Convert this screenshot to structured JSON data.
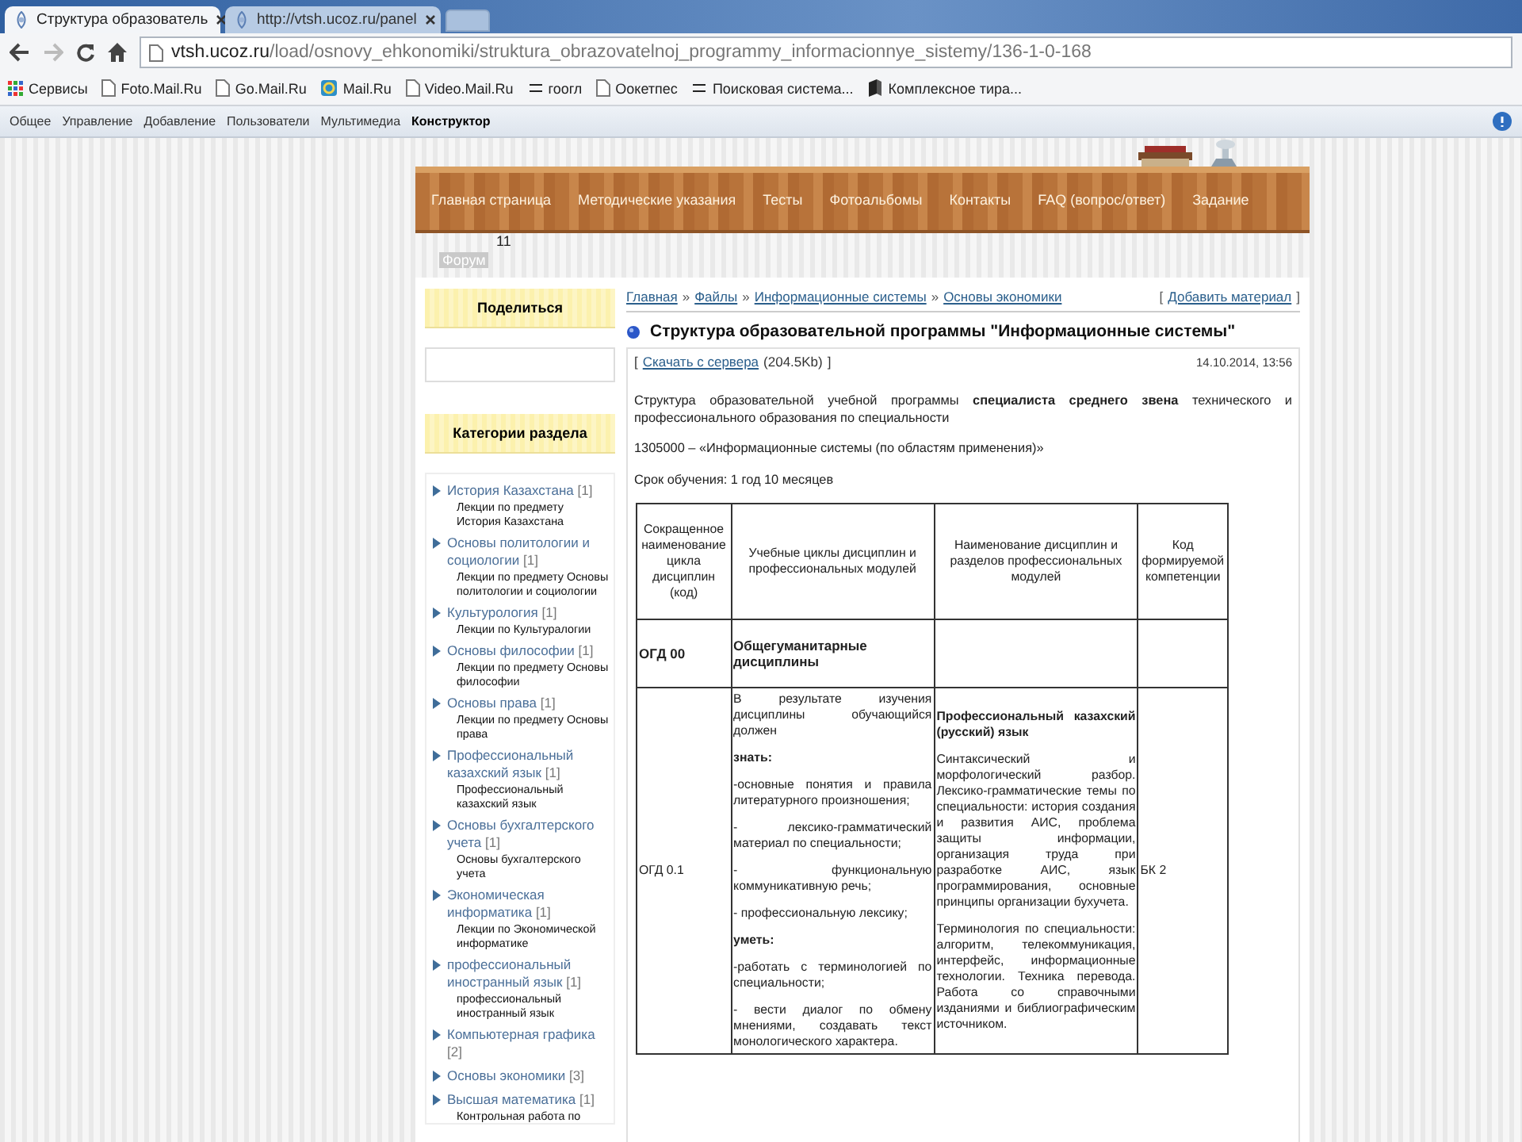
{
  "browser": {
    "tabs": [
      {
        "title": "Структура образователь",
        "selected": true
      },
      {
        "title": "http://vtsh.ucoz.ru/panel",
        "selected": false
      }
    ],
    "url": {
      "host": "vtsh.ucoz.ru",
      "path": "/load/osnovy_ehkonomiki/struktura_obrazovatelnoj_programmy_informacionnye_sistemy/136-1-0-168"
    },
    "forward_disabled": true,
    "bookmarks": [
      {
        "label": "Сервисы",
        "kind": "apps"
      },
      {
        "label": "Foto.Mail.Ru",
        "kind": "page"
      },
      {
        "label": "Go.Mail.Ru",
        "kind": "page"
      },
      {
        "label": "Mail.Ru",
        "kind": "mail"
      },
      {
        "label": "Video.Mail.Ru",
        "kind": "page"
      },
      {
        "label": "гоогл",
        "kind": "wiki"
      },
      {
        "label": "Оокетпес",
        "kind": "page"
      },
      {
        "label": "Поисковая система...",
        "kind": "wiki"
      },
      {
        "label": "Комплексное тира...",
        "kind": "book"
      }
    ]
  },
  "admin_panel": {
    "items": [
      {
        "label": "Общее",
        "selected": false
      },
      {
        "label": "Управление",
        "selected": false
      },
      {
        "label": "Добавление",
        "selected": false
      },
      {
        "label": "Пользователи",
        "selected": false
      },
      {
        "label": "Мультимедиа",
        "selected": false
      },
      {
        "label": "Конструктор",
        "selected": true
      }
    ]
  },
  "site": {
    "nav": [
      "Главная страница",
      "Методические указания",
      "Тесты",
      "Фотоальбомы",
      "Контакты",
      "FAQ (вопрос/ответ)",
      "Задание"
    ],
    "nav_second_line": "Форум",
    "counter": "11"
  },
  "sidebar": {
    "share_title": "Поделиться",
    "categories_title": "Категории раздела",
    "categories": [
      {
        "name": "История Казахстана",
        "count": "[1]",
        "description": "Лекции по предмету История Казахстана"
      },
      {
        "name": "Основы политологии и социологии",
        "count": "[1]",
        "description": "Лекции по предмету Основы политологии и социологии"
      },
      {
        "name": "Культурология",
        "count": "[1]",
        "description": "Лекции по Культуралогии"
      },
      {
        "name": "Основы философии",
        "count": "[1]",
        "description": "Лекции по предмету Основы философии"
      },
      {
        "name": "Основы права",
        "count": "[1]",
        "description": "Лекции по предмету Основы права"
      },
      {
        "name": "Профессиональный казахский язык",
        "count": "[1]",
        "description": "Профессиональный казахский язык"
      },
      {
        "name": "Основы бухгалтерского учета",
        "count": "[1]",
        "description": "Основы бухгалтерского учета"
      },
      {
        "name": "Экономическая информатика",
        "count": "[1]",
        "description": "Лекции по Экономической информатике"
      },
      {
        "name": "профессиональный иностранный язык",
        "count": "[1]",
        "description": "профессиональный иностранный язык"
      },
      {
        "name": "Компьютерная графика",
        "count": "[2]"
      },
      {
        "name": "Основы экономики",
        "count": "[3]"
      },
      {
        "name": "Высшая математика",
        "count": "[1]",
        "description": "Контрольная работа по"
      }
    ]
  },
  "content": {
    "breadcrumbs": [
      "Главная",
      "Файлы",
      "Информационные системы",
      "Основы экономики"
    ],
    "separator": "»",
    "add_material": {
      "open": "[",
      "link": "Добавить материал",
      "close": "]"
    },
    "title": "Структура образовательной программы \"Информационные системы\"",
    "download": {
      "open": "[",
      "link": "Скачать с сервера",
      "size": "(204.5Kb)",
      "close": "]"
    },
    "date": "14.10.2014, 13:56",
    "paragraphs": [
      "Структура образовательной учебной программы **специалиста среднего звена** технического и профессионального образования по специальности",
      "1305000 – «Информационные системы (по областям применения)»",
      "Срок обучения: 1 год 10 месяцев"
    ],
    "table": {
      "rows": [
        {
          "kind": "header",
          "cells": [
            [
              {
                "text": "Сокращенное наименование цикла дисциплин (код)",
                "bold": false
              }
            ],
            [
              {
                "text": "Учебные циклы дисциплин и профессиональных модулей",
                "bold": false
              }
            ],
            [
              {
                "text": "Наименование дисциплин и разделов профессиональных модулей",
                "bold": false
              }
            ],
            [
              {
                "text": "Код формируемой компетенции",
                "bold": false
              }
            ]
          ]
        },
        {
          "kind": "group",
          "cells": [
            [
              {
                "text": "ОГД 00",
                "bold": true
              }
            ],
            [
              {
                "text": "Общегуманитарные дисциплины",
                "bold": true
              }
            ],
            [],
            []
          ]
        },
        {
          "kind": "item",
          "cells": [
            [
              {
                "text": "ОГД 0.1",
                "bold": false
              }
            ],
            [
              {
                "text": "В результате изучения дисциплины обучающийся должен",
                "bold": false
              },
              {
                "text": "знать:",
                "bold": true
              },
              {
                "text": "-основные понятия и правила литературного произношения;",
                "bold": false
              },
              {
                "text": "- лексико-грамматический материал по специальности;",
                "bold": false
              },
              {
                "text": "- функциональную коммуникативную речь;",
                "bold": false
              },
              {
                "text": "- профессиональную лексику;",
                "bold": false
              },
              {
                "text": "уметь:",
                "bold": true
              },
              {
                "text": "-работать с терминологией по специальности;",
                "bold": false
              },
              {
                "text": "- вести диалог по обмену мнениями, создавать текст монологического характера.",
                "bold": false
              }
            ],
            [
              {
                "text": "Профессиональный казахский (русский) язык",
                "bold": true
              },
              {
                "text": "Синтаксический и морфологический разбор. Лексико-грамматические темы по специальности: история создания и развития АИС, проблема защиты информации, организация труда при разработке АИС, язык программирования, основные принципы организации бухучета.",
                "bold": false
              },
              {
                "text": "Терминология по специальности: алгоритм, телекоммуникация, интерфейс, информационные технологии. Техника перевода. Работа со справочными изданиями и библиографическим источником.",
                "bold": false
              }
            ],
            [
              {
                "text": "БК 2",
                "bold": false
              }
            ]
          ]
        }
      ]
    }
  }
}
